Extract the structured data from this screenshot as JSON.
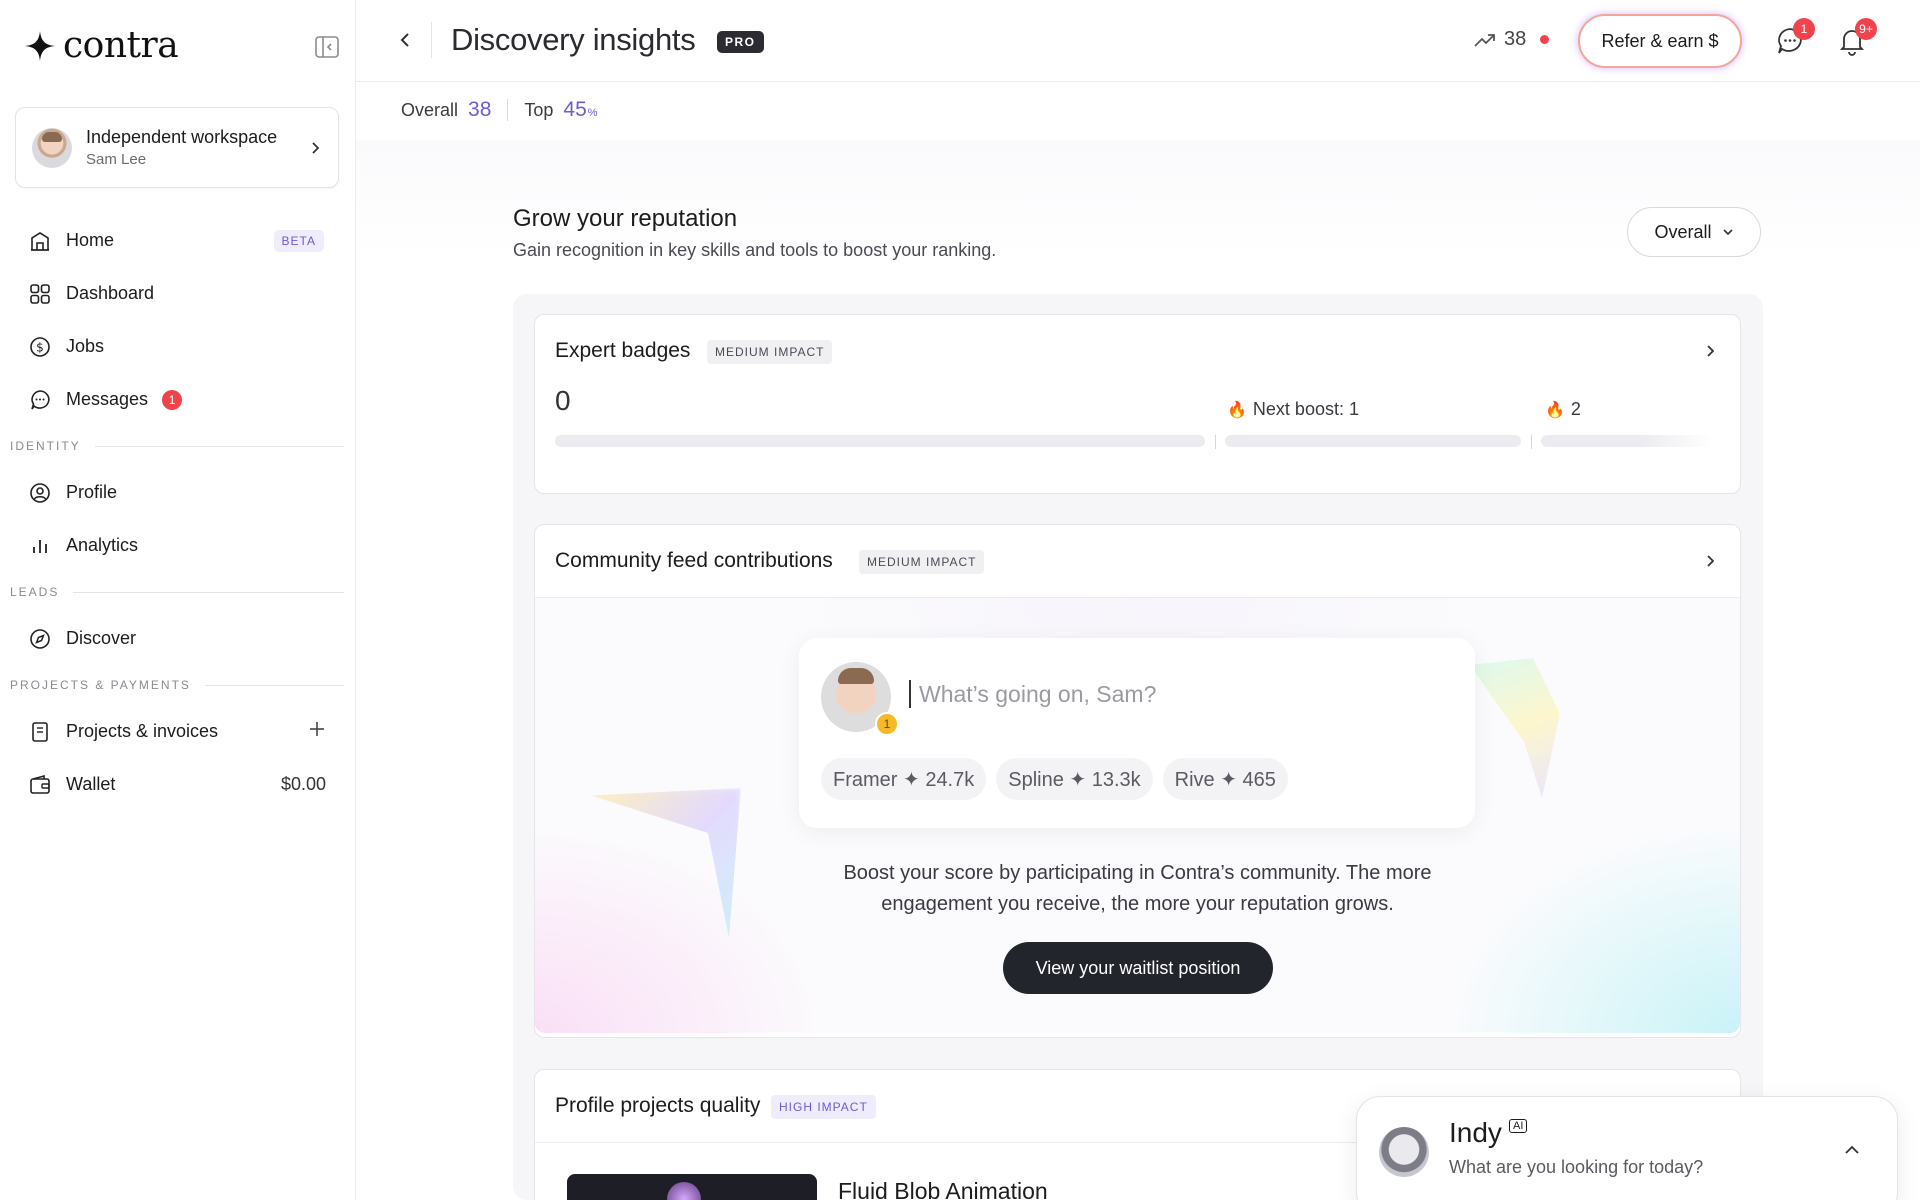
{
  "app": {
    "logo_text": "contra"
  },
  "workspace": {
    "title": "Independent workspace",
    "user": "Sam Lee"
  },
  "nav": {
    "home": {
      "label": "Home",
      "badge": "BETA"
    },
    "dashboard": {
      "label": "Dashboard"
    },
    "jobs": {
      "label": "Jobs"
    },
    "messages": {
      "label": "Messages",
      "badge": "1"
    },
    "section_identity": "IDENTITY",
    "profile": {
      "label": "Profile"
    },
    "analytics": {
      "label": "Analytics"
    },
    "section_leads": "LEADS",
    "discover": {
      "label": "Discover"
    },
    "section_projects": "PROJECTS & PAYMENTS",
    "projects": {
      "label": "Projects & invoices"
    },
    "wallet": {
      "label": "Wallet",
      "amount": "$0.00"
    }
  },
  "header": {
    "title": "Discovery insights",
    "pro_badge": "PRO",
    "score": "38",
    "refer_label": "Refer & earn $",
    "messages_badge": "1",
    "notifications_badge": "9+"
  },
  "stats": {
    "overall_label": "Overall",
    "overall_value": "38",
    "top_label": "Top",
    "top_value": "45",
    "top_unit": "%"
  },
  "reputation": {
    "title": "Grow your reputation",
    "subtitle": "Gain recognition in key skills and tools to boost your ranking.",
    "filter": "Overall"
  },
  "expert_badges": {
    "title": "Expert badges",
    "impact": "MEDIUM IMPACT",
    "value": "0",
    "next_boost": "Next boost: 1",
    "next_level": "2"
  },
  "community": {
    "title": "Community feed contributions",
    "impact": "MEDIUM IMPACT",
    "composer_placeholder": "What’s going on, Sam?",
    "avatar_badge": "1",
    "chips": [
      "Framer ✦ 24.7k",
      "Spline ✦ 13.3k",
      "Rive ✦ 465"
    ],
    "description_line1": "Boost your score by participating in Contra’s community. The more",
    "description_line2": "engagement you receive, the more your reputation grows.",
    "cta": "View your waitlist position"
  },
  "projects_quality": {
    "title": "Profile projects quality",
    "impact": "HIGH IMPACT",
    "project_name": "Fluid Blob Animation"
  },
  "indy": {
    "name": "Indy",
    "ai_badge": "AI",
    "prompt": "What are you looking for today?"
  },
  "colors": {
    "accent": "#6c5dd3",
    "alert": "#f0434c",
    "dark_button": "#23252d"
  }
}
